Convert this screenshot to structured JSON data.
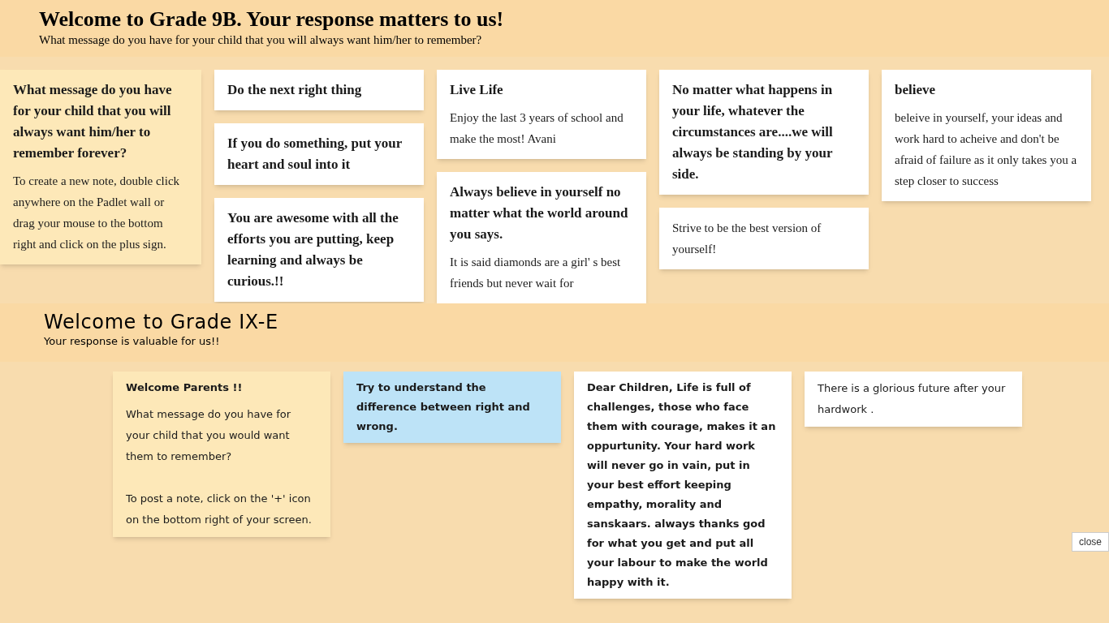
{
  "walls": [
    {
      "kind": "columns",
      "title": "Welcome to Grade 9B. Your response matters to us!",
      "subtitle": "What message do you have for your child that you will always want him/her to remember?",
      "columns": [
        [
          {
            "title": "What message do you have for your child that you will always want him/her to remember forever?",
            "body": "To create a new note, double click anywhere on the Padlet wall or drag your mouse to the bottom right and click on the plus sign.",
            "color": "#fde8b8"
          }
        ],
        [
          {
            "title": "Do the next right thing",
            "color": "#ffffff"
          },
          {
            "title": "If you do something, put your heart and soul into it",
            "color": "#ffffff"
          },
          {
            "title": "You are awesome with all the efforts you are putting, keep learning and always be curious.!!",
            "color": "#ffffff"
          }
        ],
        [
          {
            "title": "Live Life",
            "body": "Enjoy the last 3 years of school and make the most!  Avani",
            "color": "#ffffff"
          },
          {
            "title": "Always believe in yourself no matter what the world around you says.",
            "body": "It is said diamonds are a girl' s best  friends but never wait for",
            "color": "#ffffff"
          }
        ],
        [
          {
            "title": "No matter what happens in your life, whatever the circumstances are....we will always be standing by your side.",
            "color": "#ffffff"
          },
          {
            "body": "Strive to be the best version of yourself!",
            "color": "#ffffff"
          }
        ],
        [
          {
            "title": "believe",
            "body": "beleive in yourself, your ideas and work hard to acheive and don't be afraid of failure as it only takes you a step closer to success",
            "color": "#ffffff"
          }
        ]
      ]
    },
    {
      "kind": "freeform",
      "title": "Welcome to Grade IX-E",
      "subtitle": "Your response is valuable for us!!",
      "notes": [
        {
          "title": "Welcome Parents !!",
          "body": "What message do you have for your child that you would want them to remember?\n\nTo post a note, click on the '+' icon on the bottom right of your screen.",
          "color": "#fde8b8"
        },
        {
          "title": "Try to understand the difference between right and wrong.",
          "color": "#bde3f7"
        },
        {
          "title": "Dear Children, Life is full of challenges, those who face them with courage, makes it an oppurtunity. Your hard work will never go in vain, put in your best effort keeping empathy, morality and sanskaars. always thanks god for what you get and put all your labour to make the world happy with it.",
          "color": "#ffffff"
        },
        {
          "body": "There is a glorious future after your hardwork .",
          "color": "#ffffff"
        }
      ]
    }
  ],
  "close_button": "close"
}
